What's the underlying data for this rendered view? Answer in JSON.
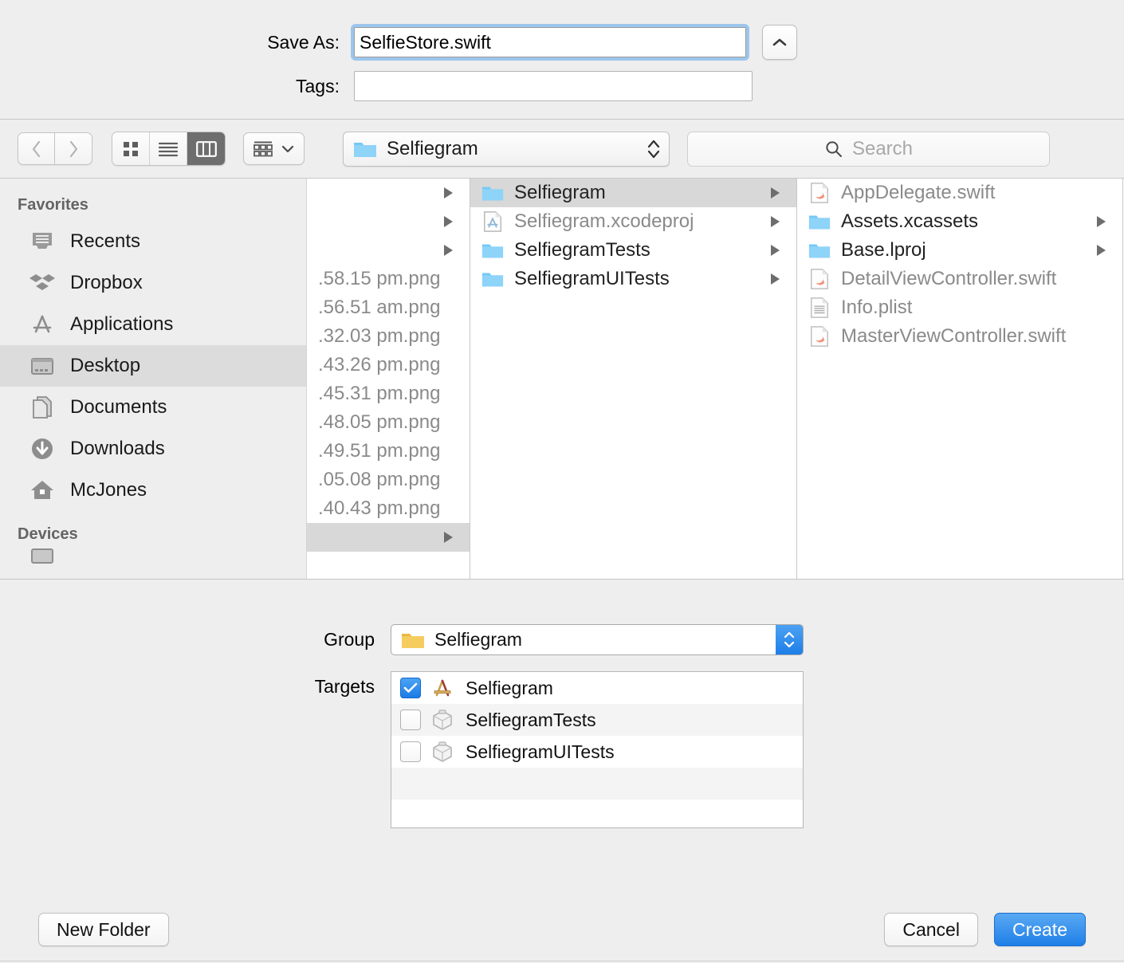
{
  "save_panel": {
    "save_as_label": "Save As:",
    "filename_value": "SelfieStore.swift",
    "tags_label": "Tags:",
    "tags_value": "",
    "tags_placeholder": "",
    "collapse_icon": "chevron-up-icon"
  },
  "toolbar": {
    "back_icon": "chevron-left-icon",
    "forward_icon": "chevron-right-icon",
    "view_modes": [
      {
        "name": "icon-view",
        "icon": "grid-icon",
        "active": false
      },
      {
        "name": "list-view",
        "icon": "list-icon",
        "active": false
      },
      {
        "name": "column-view",
        "icon": "columns-icon",
        "active": true
      }
    ],
    "arrange_icon": "arrange-grid-icon",
    "arrange_chevron": "chevron-down-icon",
    "path_popup": {
      "icon": "blue-folder-icon",
      "label": "Selfiegram",
      "stepper_icon": "chevron-up-down-icon"
    },
    "search": {
      "icon": "search-icon",
      "placeholder": "Search",
      "value": ""
    }
  },
  "sidebar": {
    "sections": [
      {
        "header": "Favorites",
        "items": [
          {
            "label": "Recents",
            "icon": "recents-icon",
            "selected": false
          },
          {
            "label": "Dropbox",
            "icon": "dropbox-icon",
            "selected": false
          },
          {
            "label": "Applications",
            "icon": "applications-icon",
            "selected": false
          },
          {
            "label": "Desktop",
            "icon": "desktop-icon",
            "selected": true
          },
          {
            "label": "Documents",
            "icon": "documents-icon",
            "selected": false
          },
          {
            "label": "Downloads",
            "icon": "downloads-icon",
            "selected": false
          },
          {
            "label": "McJones",
            "icon": "home-icon",
            "selected": false
          }
        ]
      },
      {
        "header": "Devices",
        "items": []
      }
    ]
  },
  "browser": {
    "columns": [
      {
        "name": "column-one",
        "rows": [
          {
            "label": "",
            "icon": "none",
            "dim": false,
            "has_arrow": true,
            "selected": false
          },
          {
            "label": "",
            "icon": "none",
            "dim": false,
            "has_arrow": true,
            "selected": false
          },
          {
            "label": "",
            "icon": "none",
            "dim": false,
            "has_arrow": true,
            "selected": false
          },
          {
            "label": ".58.15 pm.png",
            "icon": "none",
            "dim": true,
            "has_arrow": false,
            "selected": false
          },
          {
            "label": ".56.51 am.png",
            "icon": "none",
            "dim": true,
            "has_arrow": false,
            "selected": false
          },
          {
            "label": ".32.03 pm.png",
            "icon": "none",
            "dim": true,
            "has_arrow": false,
            "selected": false
          },
          {
            "label": ".43.26 pm.png",
            "icon": "none",
            "dim": true,
            "has_arrow": false,
            "selected": false
          },
          {
            "label": ".45.31 pm.png",
            "icon": "none",
            "dim": true,
            "has_arrow": false,
            "selected": false
          },
          {
            "label": ".48.05 pm.png",
            "icon": "none",
            "dim": true,
            "has_arrow": false,
            "selected": false
          },
          {
            "label": ".49.51 pm.png",
            "icon": "none",
            "dim": true,
            "has_arrow": false,
            "selected": false
          },
          {
            "label": ".05.08 pm.png",
            "icon": "none",
            "dim": true,
            "has_arrow": false,
            "selected": false
          },
          {
            "label": ".40.43 pm.png",
            "icon": "none",
            "dim": true,
            "has_arrow": false,
            "selected": false
          },
          {
            "label": "",
            "icon": "none",
            "dim": false,
            "has_arrow": true,
            "selected": true
          }
        ]
      },
      {
        "name": "column-two",
        "rows": [
          {
            "label": "Selfiegram",
            "icon": "blue-folder-icon",
            "dim": false,
            "has_arrow": true,
            "selected": true
          },
          {
            "label": "Selfiegram.xcodeproj",
            "icon": "xcodeproj-icon",
            "dim": true,
            "has_arrow": true,
            "selected": false
          },
          {
            "label": "SelfiegramTests",
            "icon": "blue-folder-icon",
            "dim": false,
            "has_arrow": true,
            "selected": false
          },
          {
            "label": "SelfiegramUITests",
            "icon": "blue-folder-icon",
            "dim": false,
            "has_arrow": true,
            "selected": false
          }
        ]
      },
      {
        "name": "column-three",
        "rows": [
          {
            "label": "AppDelegate.swift",
            "icon": "swift-file-icon",
            "dim": true,
            "has_arrow": false,
            "selected": false
          },
          {
            "label": "Assets.xcassets",
            "icon": "blue-folder-icon",
            "dim": false,
            "has_arrow": true,
            "selected": false
          },
          {
            "label": "Base.lproj",
            "icon": "blue-folder-icon",
            "dim": false,
            "has_arrow": true,
            "selected": false
          },
          {
            "label": "DetailViewController.swift",
            "icon": "swift-file-icon",
            "dim": true,
            "has_arrow": false,
            "selected": false
          },
          {
            "label": "Info.plist",
            "icon": "plist-file-icon",
            "dim": true,
            "has_arrow": false,
            "selected": false
          },
          {
            "label": "MasterViewController.swift",
            "icon": "swift-file-icon",
            "dim": true,
            "has_arrow": false,
            "selected": false
          }
        ]
      }
    ]
  },
  "accessory": {
    "group_label": "Group",
    "group_value": "Selfiegram",
    "group_icon": "yellow-folder-icon",
    "targets_label": "Targets",
    "targets": [
      {
        "label": "Selfiegram",
        "checked": true,
        "icon": "xcode-target-icon"
      },
      {
        "label": "SelfiegramTests",
        "checked": false,
        "icon": "test-bundle-icon"
      },
      {
        "label": "SelfiegramUITests",
        "checked": false,
        "icon": "test-bundle-icon"
      }
    ]
  },
  "footer": {
    "new_folder_label": "New Folder",
    "cancel_label": "Cancel",
    "create_label": "Create"
  },
  "colors": {
    "accent_blue": "#1f7fe8",
    "focus_ring": "#9dc6ec",
    "selection_grey": "#d8d8d8",
    "folder_blue": "#6fc5f5",
    "folder_yellow": "#f0bf4c",
    "panel_grey": "#eeeeee"
  }
}
